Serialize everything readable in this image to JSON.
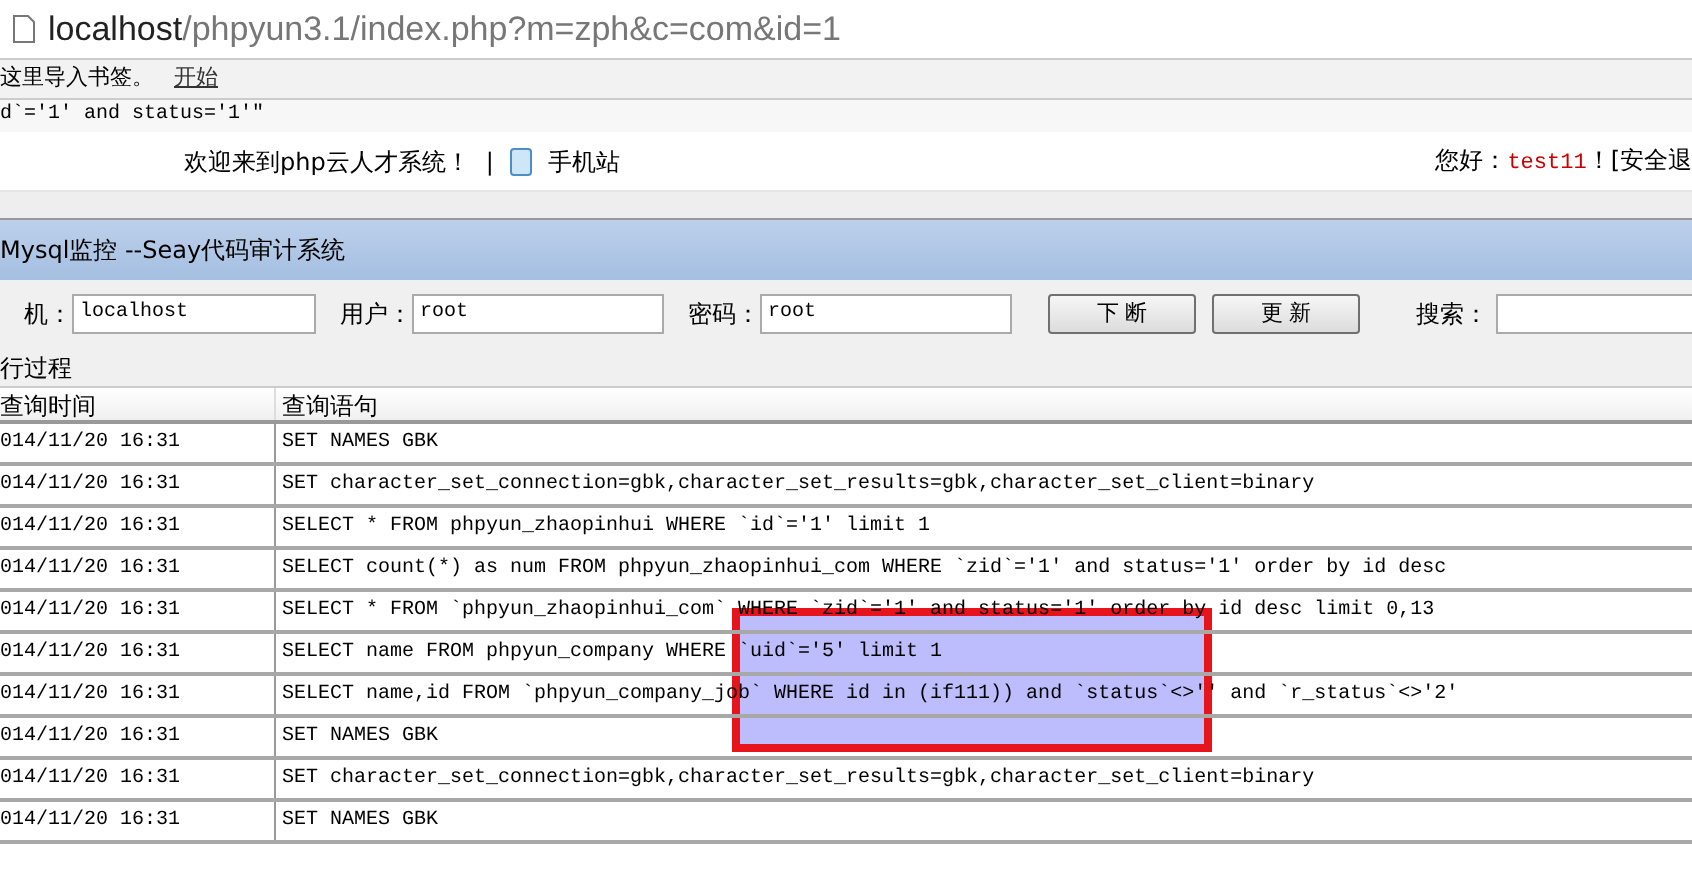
{
  "address_bar": {
    "host": "localhost",
    "path": "/phpyun3.1/index.php?m=zph&c=com&id=1"
  },
  "bookmarks_bar": {
    "hint": "这里导入书签。",
    "link": "开始"
  },
  "leaked_text": "d`='1' and status='1'\"",
  "site_header": {
    "welcome": "欢迎来到php云人才系统！",
    "separator": "|",
    "mobile_link": "手机站",
    "greeting": "您好：",
    "username": "test11",
    "after_user": "！[安全退"
  },
  "window": {
    "title": "Mysql监控 --Seay代码审计系统"
  },
  "form": {
    "fields": [
      {
        "label": "机：",
        "value": "localhost"
      },
      {
        "label": "用户：",
        "value": "root"
      },
      {
        "label": "密码：",
        "value": "root"
      }
    ],
    "buttons": [
      "下 断",
      "更 新"
    ],
    "search_label": "搜索："
  },
  "section_title": "行过程",
  "table": {
    "columns": [
      "查询时间",
      "查询语句"
    ],
    "rows": [
      [
        "014/11/20 16:31",
        "SET NAMES GBK"
      ],
      [
        "014/11/20 16:31",
        "SET character_set_connection=gbk,character_set_results=gbk,character_set_client=binary"
      ],
      [
        "014/11/20 16:31",
        "SELECT * FROM phpyun_zhaopinhui WHERE `id`='1' limit 1"
      ],
      [
        "014/11/20 16:31",
        "SELECT count(*) as num FROM phpyun_zhaopinhui_com WHERE `zid`='1' and status='1'  order by id desc"
      ],
      [
        "014/11/20 16:31",
        "SELECT * FROM `phpyun_zhaopinhui_com` WHERE `zid`='1' and status='1'  order by id desc limit 0,13"
      ],
      [
        "014/11/20 16:31",
        "SELECT name FROM phpyun_company WHERE `uid`='5' limit 1"
      ],
      [
        "014/11/20 16:31",
        "SELECT name,id FROM `phpyun_company_job` WHERE id in (if111)) and `status`<>'' and `r_status`<>'2'"
      ],
      [
        "014/11/20 16:31",
        "SET NAMES GBK"
      ],
      [
        "014/11/20 16:31",
        "SET character_set_connection=gbk,character_set_results=gbk,character_set_client=binary"
      ],
      [
        "014/11/20 16:31",
        "SET NAMES GBK"
      ]
    ]
  }
}
